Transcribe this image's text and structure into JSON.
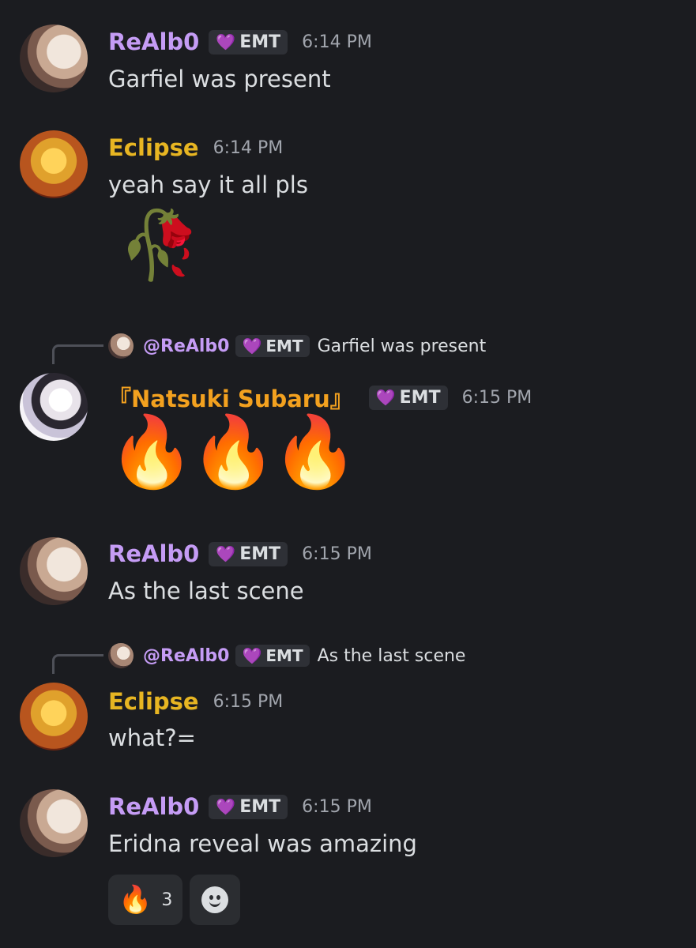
{
  "messages": [
    {
      "author": "ReAlb0",
      "badge": "EMT",
      "time": "6:14 PM",
      "text": "Garfiel was present"
    },
    {
      "author": "Eclipse",
      "time": "6:14 PM",
      "text": "yeah say it all pls",
      "emoji": "🥀"
    },
    {
      "reply": {
        "author": "@ReAlb0",
        "badge": "EMT",
        "text": "Garfiel was present"
      },
      "author": "『Natsuki Subaru』",
      "badge": "EMT",
      "time": "6:15 PM",
      "emoji": "🔥🔥🔥"
    },
    {
      "author": "ReAlb0",
      "badge": "EMT",
      "time": "6:15 PM",
      "text": "As the last scene"
    },
    {
      "reply": {
        "author": "@ReAlb0",
        "badge": "EMT",
        "text": "As the last scene"
      },
      "author": "Eclipse",
      "time": "6:15 PM",
      "text": "what?="
    },
    {
      "author": "ReAlb0",
      "badge": "EMT",
      "time": "6:15 PM",
      "text": "Eridna reveal was amazing",
      "reactions": [
        {
          "emoji": "🔥",
          "count": "3"
        }
      ]
    }
  ],
  "icons": {
    "badge_icon": "purple-heart-icon",
    "add_reaction": "smiley-face-icon"
  },
  "colors": {
    "background": "#1b1c20",
    "realbo": "#c59cf5",
    "eclipse": "#e7b522",
    "subaru": "#f3a11f"
  }
}
